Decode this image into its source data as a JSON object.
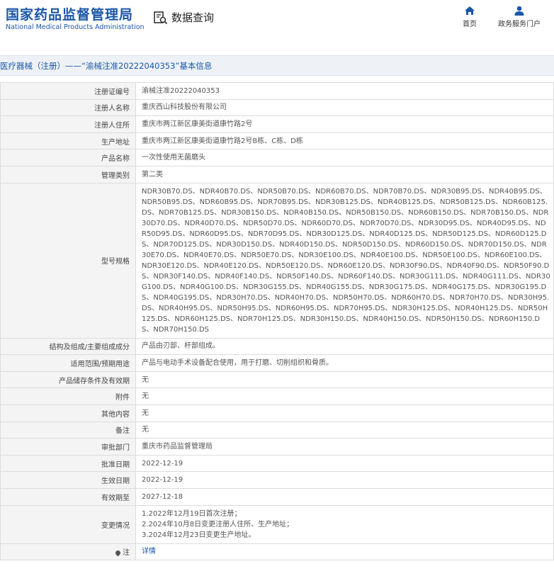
{
  "header": {
    "logo_cn": "国家药品监督管理局",
    "logo_en": "National Medical Products Administration",
    "query_label": "数据查询",
    "nav_home": "首页",
    "nav_gov": "政务服务门户"
  },
  "breadcrumb": "医疗器械（注册）——“渝械注准20222040353”基本信息",
  "rows": [
    {
      "label": "注册证编号",
      "value": "渝械注准20222040353"
    },
    {
      "label": "注册人名称",
      "value": "重庆西山科技股份有限公司"
    },
    {
      "label": "注册人住所",
      "value": "重庆市两江新区康美街道康竹路2号"
    },
    {
      "label": "生产地址",
      "value": "重庆市两江新区康美街道康竹路2号B栋、C栋、D栋"
    },
    {
      "label": "产品名称",
      "value": "一次性使用无菌磨头"
    },
    {
      "label": "管理类别",
      "value": "第二类"
    },
    {
      "label": "型号规格",
      "value": "NDR30B70.DS、NDR40B70.DS、NDR50B70.DS、NDR60B70.DS、NDR70B70.DS、NDR30B95.DS、NDR40B95.DS、NDR50B95.DS、NDR60B95.DS、NDR70B95.DS、NDR30B125.DS、NDR40B125.DS、NDR50B125.DS、NDR60B125.DS、NDR70B125.DS、NDR30B150.DS、NDR40B150.DS、NDR50B150.DS、NDR60B150.DS、NDR70B150.DS、NDR30D70.DS、NDR40D70.DS、NDR50D70.DS、NDR60D70.DS、NDR70D70.DS、NDR30D95.DS、NDR40D95.DS、NDR50D95.DS、NDR60D95.DS、NDR70D95.DS、NDR30D125.DS、NDR40D125.DS、NDR50D125.DS、NDR60D125.DS、NDR70D125.DS、NDR30D150.DS、NDR40D150.DS、NDR50D150.DS、NDR60D150.DS、NDR70D150.DS、NDR30E70.DS、NDR40E70.DS、NDR50E70.DS、NDR30E100.DS、NDR40E100.DS、NDR50E100.DS、NDR60E100.DS、NDR30E120.DS、NDR40E120.DS、NDR50E120.DS、NDR60E120.DS、NDR30F90.DS、NDR40F90.DS、NDR50F90.DS、NDR30F140.DS、NDR40F140.DS、NDR50F140.DS、NDR60F140.DS、NDR30G111.DS、NDR40G111.DS、NDR30G100.DS、NDR40G100.DS、NDR30G155.DS、NDR40G155.DS、NDR30G175.DS、NDR40G175.DS、NDR30G195.DS、NDR40G195.DS、NDR30H70.DS、NDR40H70.DS、NDR50H70.DS、NDR60H70.DS、NDR70H70.DS、NDR30H95.DS、NDR40H95.DS、NDR50H95.DS、NDR60H95.DS、NDR70H95.DS、NDR30H125.DS、NDR40H125.DS、NDR50H125.DS、NDR60H125.DS、NDR70H125.DS、NDR30H150.DS、NDR40H150.DS、NDR50H150.DS、NDR60H150.DS、NDR70H150.DS"
    },
    {
      "label": "结构及组成/主要组成成分",
      "value": "产品由刃部、杆部组成。"
    },
    {
      "label": "适用范围/预期用途",
      "value": "产品与电动手术设备配合使用，用于打磨、切削组织和骨质。"
    },
    {
      "label": "产品储存条件及有效期",
      "value": "无"
    },
    {
      "label": "附件",
      "value": "无"
    },
    {
      "label": "其他内容",
      "value": "无"
    },
    {
      "label": "备注",
      "value": "无"
    },
    {
      "label": "审批部门",
      "value": "重庆市药品监督管理局"
    },
    {
      "label": "批准日期",
      "value": "2022-12-19"
    },
    {
      "label": "生效日期",
      "value": "2022-12-19"
    },
    {
      "label": "有效期至",
      "value": "2027-12-18"
    },
    {
      "label": "变更情况",
      "value": "1.2022年12月19日首次注册；\n2.2024年10月8日变更注册人住所、生产地址；\n3.2024年12月23日变更生产地址。"
    },
    {
      "label": "注",
      "value": "详情"
    }
  ]
}
